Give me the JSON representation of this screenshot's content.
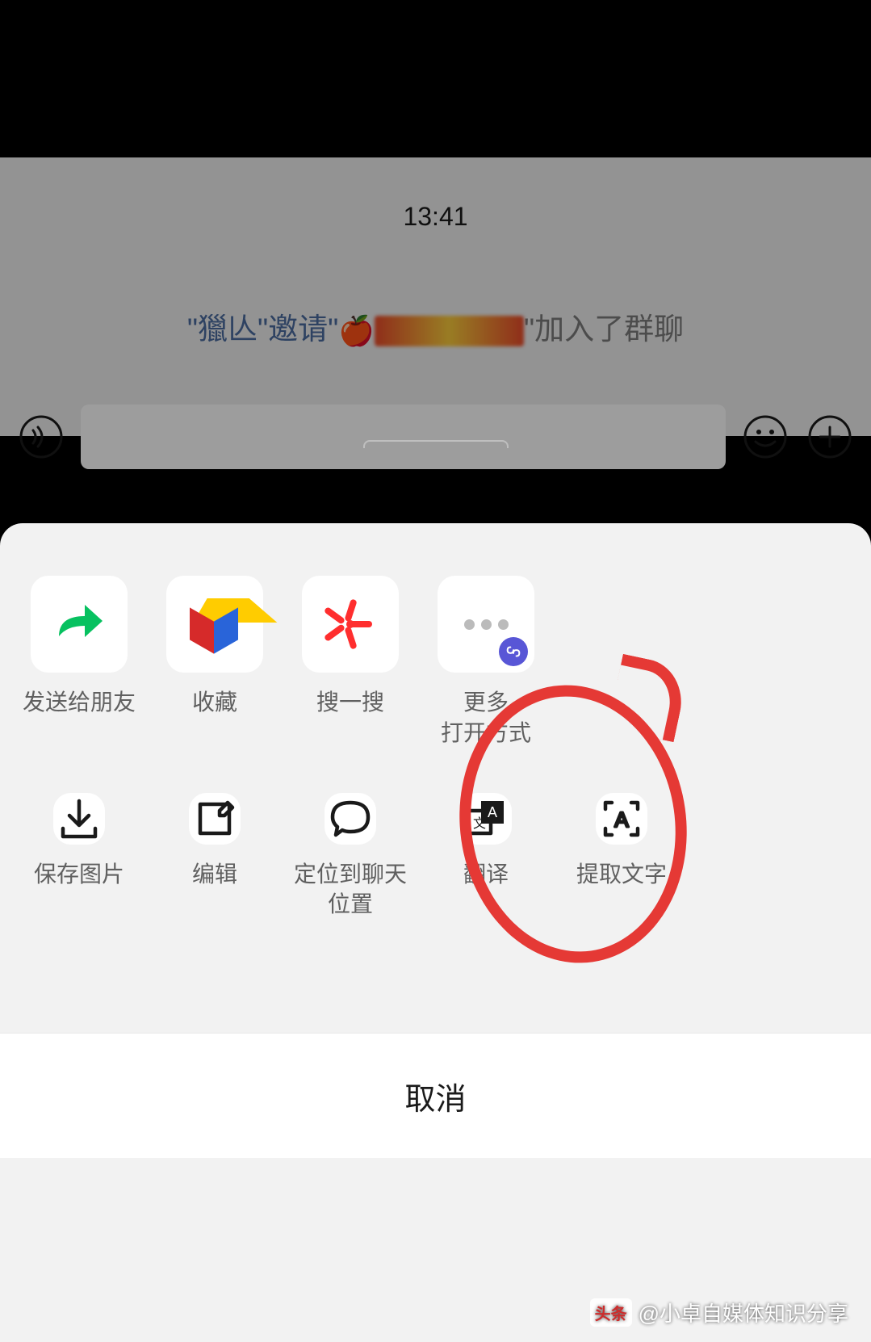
{
  "chat": {
    "time": "13:41",
    "message_prefix": "\"獵亾\"邀请\"",
    "message_suffix": "\"加入了群聊"
  },
  "sheet": {
    "row1": [
      {
        "label": "发送给朋友",
        "icon": "share"
      },
      {
        "label": "收藏",
        "icon": "favorite"
      },
      {
        "label": "搜一搜",
        "icon": "search"
      },
      {
        "label": "更多\n打开方式",
        "icon": "more"
      }
    ],
    "row2": [
      {
        "label": "保存图片",
        "icon": "download"
      },
      {
        "label": "编辑",
        "icon": "edit"
      },
      {
        "label": "定位到聊天\n位置",
        "icon": "locate"
      },
      {
        "label": "翻译",
        "icon": "translate"
      },
      {
        "label": "提取文字",
        "icon": "extract-text"
      }
    ],
    "cancel": "取消"
  },
  "watermark": {
    "badge": "头条",
    "text": "@小卓自媒体知识分享"
  }
}
